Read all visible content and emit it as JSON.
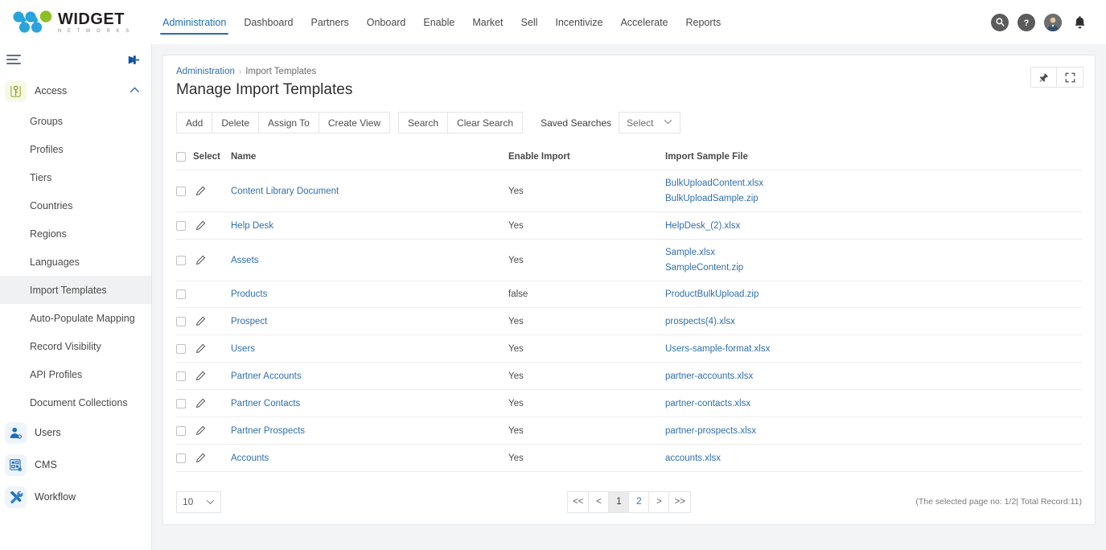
{
  "brand": {
    "name": "WIDGET",
    "tagline": "N E T W O R K S",
    "blue": "#29a3dc",
    "green": "#8cbf26",
    "accent": "#1f6fb5"
  },
  "topnav": {
    "items": [
      {
        "label": "Administration",
        "active": true
      },
      {
        "label": "Dashboard",
        "active": false
      },
      {
        "label": "Partners",
        "active": false
      },
      {
        "label": "Onboard",
        "active": false
      },
      {
        "label": "Enable",
        "active": false
      },
      {
        "label": "Market",
        "active": false
      },
      {
        "label": "Sell",
        "active": false
      },
      {
        "label": "Incentivize",
        "active": false
      },
      {
        "label": "Accelerate",
        "active": false
      },
      {
        "label": "Reports",
        "active": false
      }
    ],
    "icons": [
      "search-icon",
      "help-icon",
      "avatar",
      "notification-bell-icon"
    ]
  },
  "sidebar": {
    "menu_icon": "hamburger-icon",
    "pin_icon": "pin-icon",
    "groups": [
      {
        "label": "Access",
        "icon": "key-icon",
        "icon_color": "green",
        "expanded": true,
        "chevron": "⌃",
        "items": [
          {
            "label": "Groups",
            "active": false
          },
          {
            "label": "Profiles",
            "active": false
          },
          {
            "label": "Tiers",
            "active": false
          },
          {
            "label": "Countries",
            "active": false
          },
          {
            "label": "Regions",
            "active": false
          },
          {
            "label": "Languages",
            "active": false
          },
          {
            "label": "Import Templates",
            "active": true
          },
          {
            "label": "Auto-Populate Mapping",
            "active": false
          },
          {
            "label": "Record Visibility",
            "active": false
          },
          {
            "label": "API Profiles",
            "active": false
          },
          {
            "label": "Document Collections",
            "active": false
          }
        ]
      },
      {
        "label": "Users",
        "icon": "user-icon",
        "icon_color": "blue",
        "expanded": false,
        "items": []
      },
      {
        "label": "CMS",
        "icon": "cms-grid-icon",
        "icon_color": "blue",
        "expanded": false,
        "items": []
      },
      {
        "label": "Workflow",
        "icon": "tools-icon",
        "icon_color": "blue",
        "expanded": false,
        "items": []
      }
    ]
  },
  "breadcrumb": {
    "root": "Administration",
    "separator": "›",
    "current": "Import Templates"
  },
  "page": {
    "title": "Manage Import Templates",
    "pin_button": "pin-icon",
    "expand_button": "expand-icon"
  },
  "toolbar": {
    "primary": [
      "Add",
      "Delete",
      "Assign To",
      "Create View"
    ],
    "secondary": [
      "Search",
      "Clear Search"
    ],
    "saved_searches_label": "Saved Searches",
    "saved_searches_value": "Select"
  },
  "table": {
    "columns": [
      "Select",
      "Name",
      "Enable Import",
      "Import Sample File"
    ],
    "rows": [
      {
        "name": "Content Library Document",
        "enable": "Yes",
        "files": [
          "BulkUploadContent.xlsx",
          "BulkUploadSample.zip"
        ],
        "editable": true
      },
      {
        "name": "Help Desk",
        "enable": "Yes",
        "files": [
          "HelpDesk_(2).xlsx"
        ],
        "editable": true
      },
      {
        "name": "Assets",
        "enable": "Yes",
        "files": [
          "Sample.xlsx",
          "SampleContent.zip"
        ],
        "editable": true
      },
      {
        "name": "Products",
        "enable": "false",
        "files": [
          "ProductBulkUpload.zip"
        ],
        "editable": false
      },
      {
        "name": "Prospect",
        "enable": "Yes",
        "files": [
          "prospects(4).xlsx"
        ],
        "editable": true
      },
      {
        "name": "Users",
        "enable": "Yes",
        "files": [
          "Users-sample-format.xlsx"
        ],
        "editable": true
      },
      {
        "name": "Partner Accounts",
        "enable": "Yes",
        "files": [
          "partner-accounts.xlsx"
        ],
        "editable": true
      },
      {
        "name": "Partner Contacts",
        "enable": "Yes",
        "files": [
          "partner-contacts.xlsx"
        ],
        "editable": true
      },
      {
        "name": "Partner Prospects",
        "enable": "Yes",
        "files": [
          "partner-prospects.xlsx"
        ],
        "editable": true
      },
      {
        "name": "Accounts",
        "enable": "Yes",
        "files": [
          "accounts.xlsx"
        ],
        "editable": true
      }
    ]
  },
  "footer": {
    "page_size": "10",
    "pages": [
      {
        "label": "<<",
        "active": false,
        "nav": true
      },
      {
        "label": "<",
        "active": false,
        "nav": true
      },
      {
        "label": "1",
        "active": true,
        "nav": false
      },
      {
        "label": "2",
        "active": false,
        "nav": false
      },
      {
        "label": ">",
        "active": false,
        "nav": true
      },
      {
        "label": ">>",
        "active": false,
        "nav": true
      }
    ],
    "record_info": "(The selected page no: 1/2| Total Record:11)"
  }
}
